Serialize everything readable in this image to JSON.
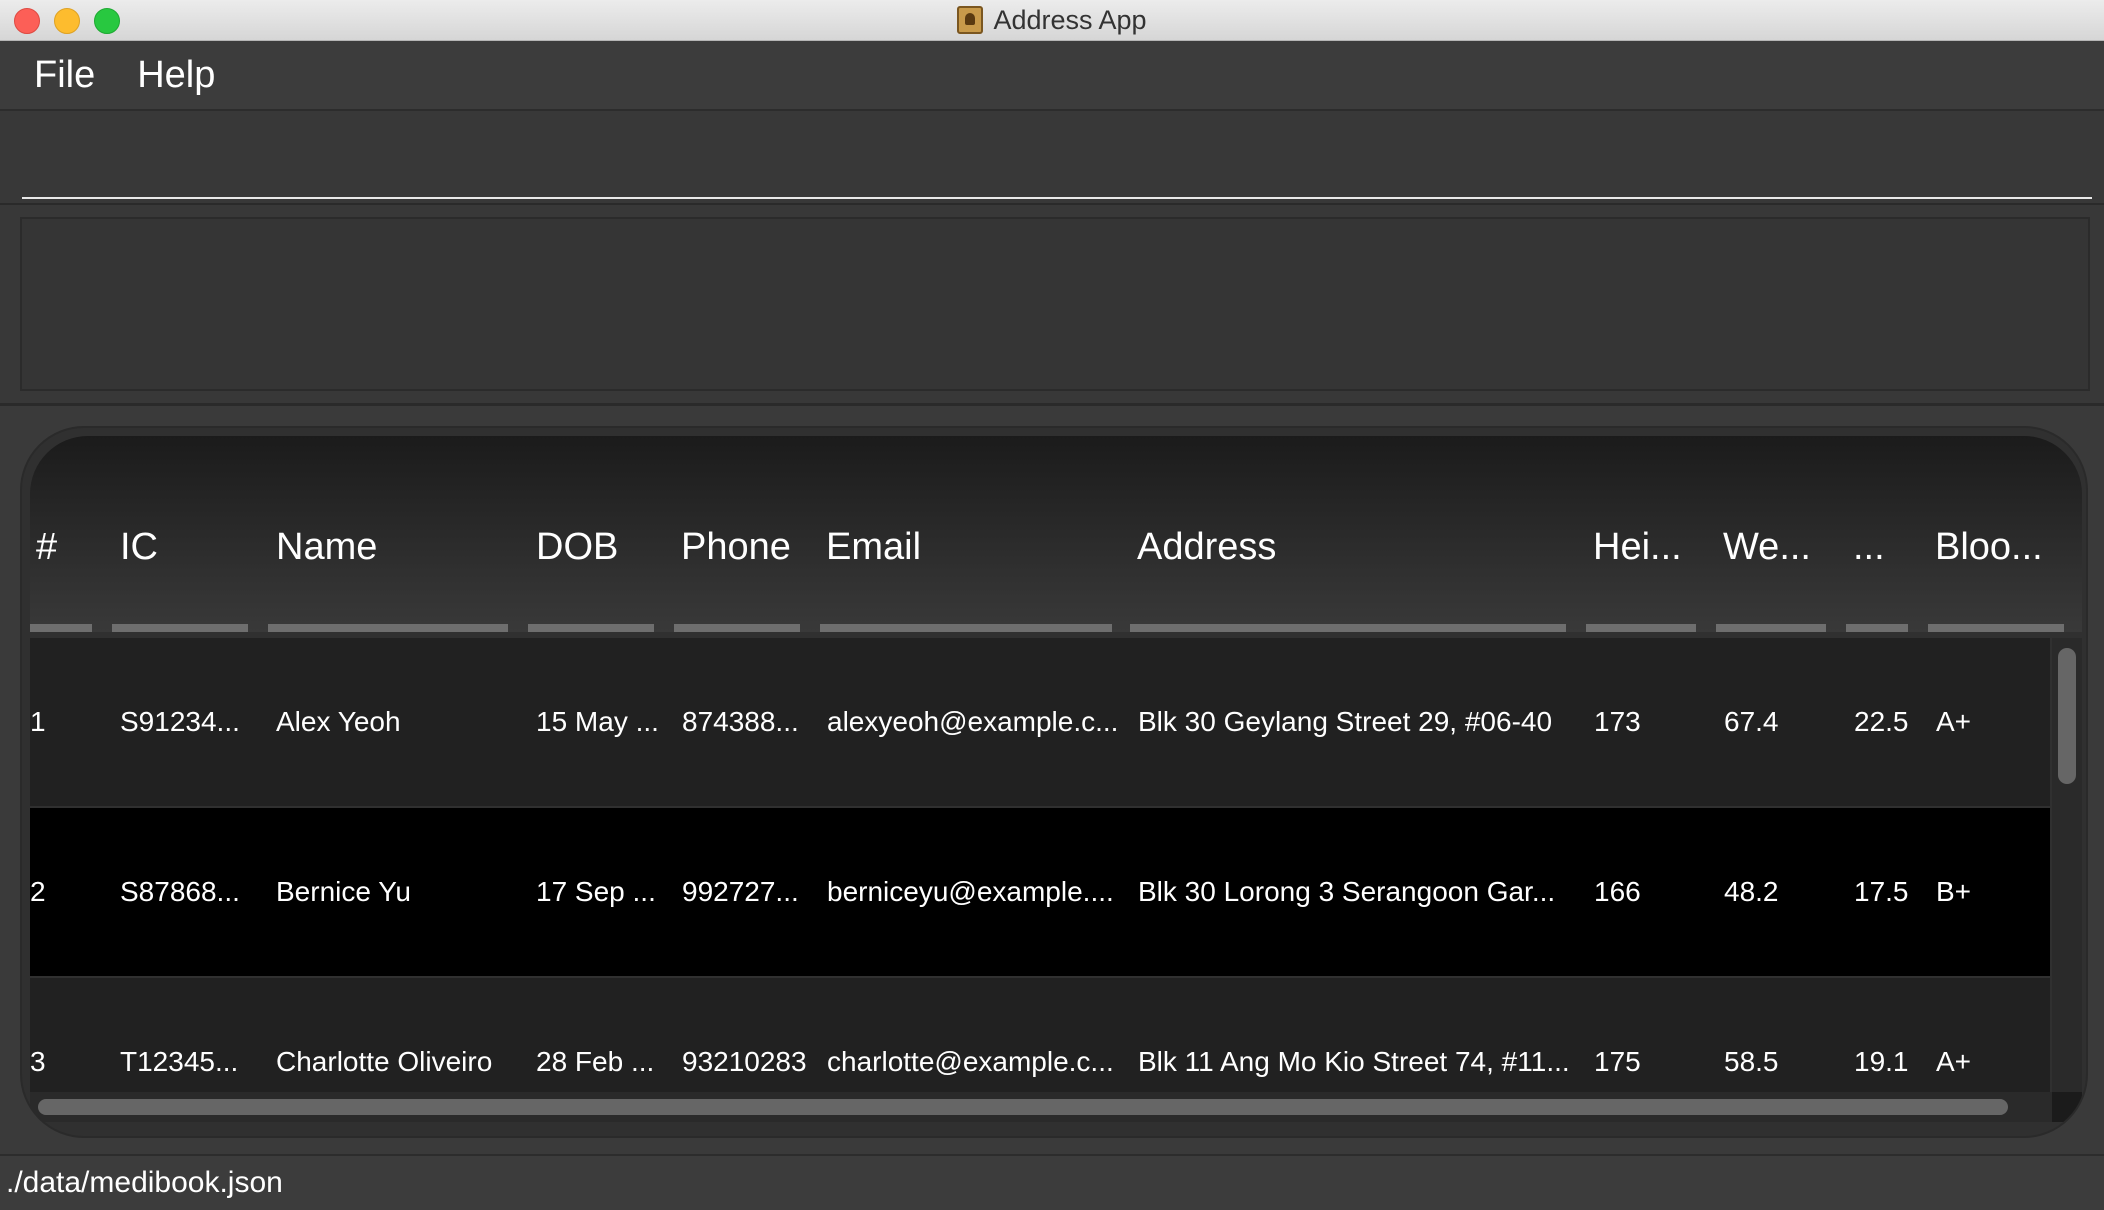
{
  "window": {
    "title": "Address App"
  },
  "menu": {
    "items": [
      "File",
      "Help"
    ]
  },
  "command": {
    "value": "",
    "placeholder": ""
  },
  "result": {
    "text": ""
  },
  "table": {
    "columns": [
      "#",
      "IC",
      "Name",
      "DOB",
      "Phone",
      "Email",
      "Address",
      "Hei...",
      "We...",
      "...",
      "Bloo..."
    ],
    "rows": [
      {
        "index": "1",
        "ic": "S91234...",
        "name": "Alex Yeoh",
        "dob": "15 May ...",
        "phone": "874388...",
        "email": "alexyeoh@example.c...",
        "address": "Blk 30 Geylang Street 29, #06-40",
        "height": "173",
        "weight": "67.4",
        "bmi": "22.5",
        "blood": "A+"
      },
      {
        "index": "2",
        "ic": "S87868...",
        "name": "Bernice Yu",
        "dob": "17 Sep ...",
        "phone": "992727...",
        "email": "berniceyu@example....",
        "address": "Blk 30 Lorong 3 Serangoon Gar...",
        "height": "166",
        "weight": "48.2",
        "bmi": "17.5",
        "blood": "B+"
      },
      {
        "index": "3",
        "ic": "T12345...",
        "name": "Charlotte Oliveiro",
        "dob": "28 Feb ...",
        "phone": "93210283",
        "email": "charlotte@example.c...",
        "address": "Blk 11 Ang Mo Kio Street 74, #11...",
        "height": "175",
        "weight": "58.5",
        "bmi": "19.1",
        "blood": "A+"
      }
    ]
  },
  "status": {
    "path": "./data/medibook.json"
  }
}
